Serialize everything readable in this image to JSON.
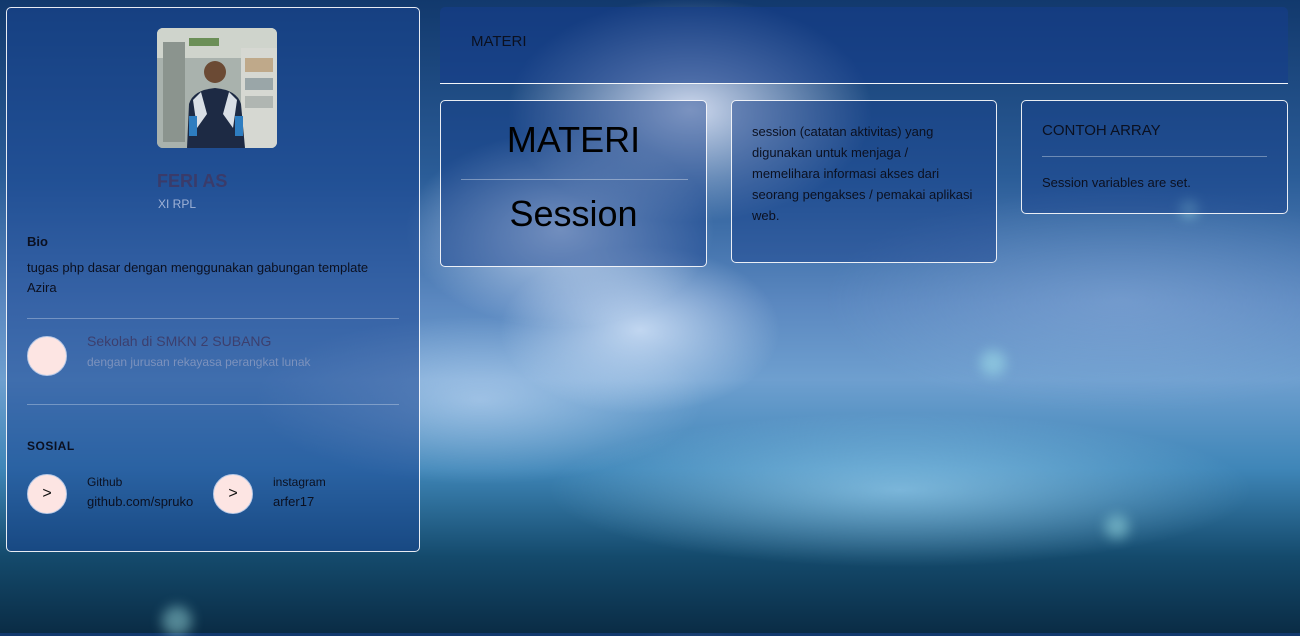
{
  "profile": {
    "name": "FERI AS",
    "class": "XI RPL",
    "bio_title": "Bio",
    "bio_text": "tugas php dasar dengan menggunakan gabungan template Azira",
    "school": {
      "title": "Sekolah di SMKN 2 SUBANG",
      "subtitle": "dengan jurusan rekayasa perangkat lunak"
    },
    "social_title": "SOSIAL",
    "social": [
      {
        "icon_text": ">",
        "label": "Github",
        "value": "github.com/spruko"
      },
      {
        "icon_text": ">",
        "label": "instagram",
        "value": "arfer17"
      }
    ]
  },
  "header": {
    "title": "MATERI"
  },
  "cards": {
    "materi": {
      "top": "MATERI",
      "bottom": "Session"
    },
    "description": {
      "text": "session (catatan aktivitas) yang digunakan untuk menjaga / memelihara informasi akses dari seorang pengakses / pemakai aplikasi web."
    },
    "array": {
      "title": "CONTOH ARRAY",
      "text": "Session variables are set."
    }
  },
  "colors": {
    "card_border": "#ffffff",
    "circle_fill": "#fde5e3",
    "name_color": "#3a3b6a"
  }
}
